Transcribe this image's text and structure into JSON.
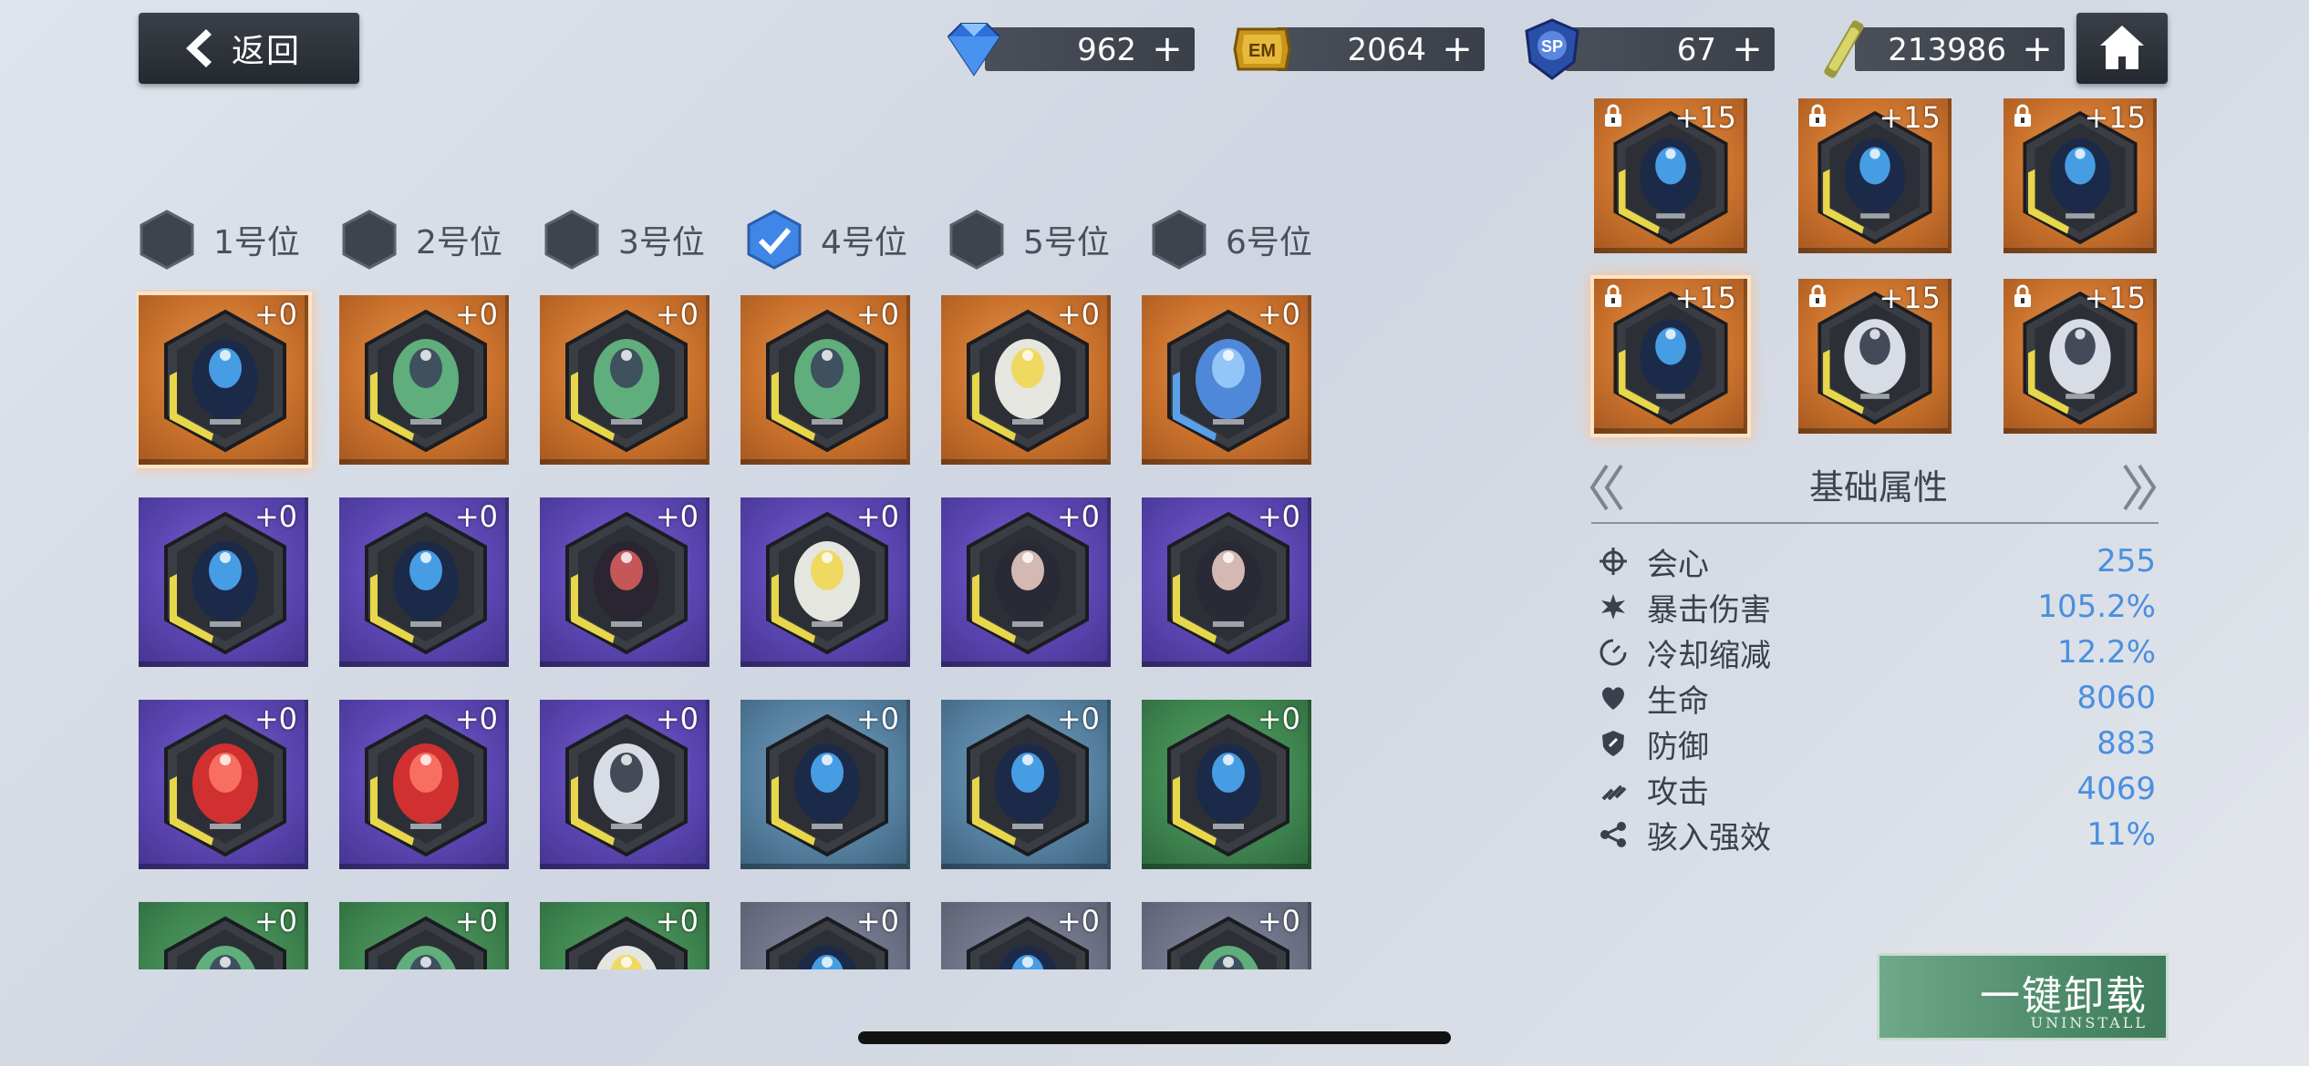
{
  "header": {
    "back_label": "返回",
    "currencies": [
      {
        "name": "diamond",
        "icon": "diamond-icon",
        "value": "962"
      },
      {
        "name": "em-coin",
        "icon": "em-coin-icon",
        "value": "2064"
      },
      {
        "name": "sp-point",
        "icon": "sp-badge-icon",
        "value": "67"
      },
      {
        "name": "material",
        "icon": "material-stick-icon",
        "value": "213986"
      }
    ],
    "plus_label": "+"
  },
  "slots": [
    {
      "label": "1号位",
      "checked": false
    },
    {
      "label": "2号位",
      "checked": false
    },
    {
      "label": "3号位",
      "checked": false
    },
    {
      "label": "4号位",
      "checked": true
    },
    {
      "label": "5号位",
      "checked": false
    },
    {
      "label": "6号位",
      "checked": false
    }
  ],
  "inventory": {
    "rows": [
      [
        {
          "color": "orange",
          "art": "dark",
          "level": "+0",
          "selected": true
        },
        {
          "color": "orange",
          "art": "green",
          "level": "+0"
        },
        {
          "color": "orange",
          "art": "green",
          "level": "+0"
        },
        {
          "color": "orange",
          "art": "green",
          "level": "+0"
        },
        {
          "color": "orange",
          "art": "white",
          "level": "+0"
        },
        {
          "color": "orange",
          "art": "blue-face",
          "level": "+0"
        }
      ],
      [
        {
          "color": "purple",
          "art": "dark",
          "level": "+0"
        },
        {
          "color": "purple",
          "art": "dark",
          "level": "+0"
        },
        {
          "color": "purple",
          "art": "red-dark",
          "level": "+0"
        },
        {
          "color": "purple",
          "art": "white",
          "level": "+0"
        },
        {
          "color": "purple",
          "art": "girl",
          "level": "+0"
        },
        {
          "color": "purple",
          "art": "girl",
          "level": "+0"
        }
      ],
      [
        {
          "color": "purple",
          "art": "red",
          "level": "+0"
        },
        {
          "color": "purple",
          "art": "red",
          "level": "+0"
        },
        {
          "color": "purple",
          "art": "silver",
          "level": "+0"
        },
        {
          "color": "teal",
          "art": "dark",
          "level": "+0"
        },
        {
          "color": "teal",
          "art": "dark",
          "level": "+0"
        },
        {
          "color": "green",
          "art": "dark",
          "level": "+0"
        }
      ],
      [
        {
          "color": "green",
          "art": "green",
          "level": "+0"
        },
        {
          "color": "green",
          "art": "green",
          "level": "+0"
        },
        {
          "color": "green",
          "art": "white",
          "level": "+0"
        },
        {
          "color": "gray",
          "art": "dark",
          "level": "+0"
        },
        {
          "color": "gray",
          "art": "dark",
          "level": "+0"
        },
        {
          "color": "gray",
          "art": "green",
          "level": "+0"
        }
      ]
    ]
  },
  "equipped": [
    {
      "color": "orange",
      "art": "dark",
      "level": "+15",
      "locked": true
    },
    {
      "color": "orange",
      "art": "dark",
      "level": "+15",
      "locked": true
    },
    {
      "color": "orange",
      "art": "dark",
      "level": "+15",
      "locked": true
    },
    {
      "color": "orange",
      "art": "dark",
      "level": "+15",
      "locked": true,
      "selected": true
    },
    {
      "color": "orange",
      "art": "silver",
      "level": "+15",
      "locked": true
    },
    {
      "color": "orange",
      "art": "silver",
      "level": "+15",
      "locked": true
    }
  ],
  "panel": {
    "title": "基础属性",
    "stats": [
      {
        "icon": "crosshair-icon",
        "name": "会心",
        "value": "255"
      },
      {
        "icon": "burst-icon",
        "name": "暴击伤害",
        "value": "105.2%"
      },
      {
        "icon": "cooldown-icon",
        "name": "冷却缩减",
        "value": "12.2%"
      },
      {
        "icon": "heart-icon",
        "name": "生命",
        "value": "8060"
      },
      {
        "icon": "shield-icon",
        "name": "防御",
        "value": "883"
      },
      {
        "icon": "attack-icon",
        "name": "攻击",
        "value": "4069"
      },
      {
        "icon": "link-icon",
        "name": "骇入强效",
        "value": "11%"
      }
    ]
  },
  "uninstall": {
    "label": "一键卸载",
    "sub_label": "UNINSTALL"
  },
  "colors": {
    "stat_value": "#4a8fe0",
    "accent_check": "#3f86e6"
  }
}
